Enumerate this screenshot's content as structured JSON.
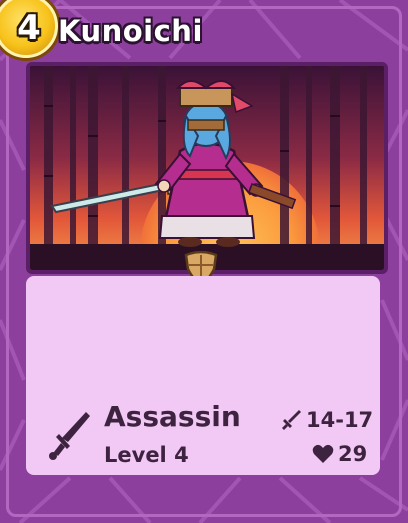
{
  "card": {
    "cost": "4",
    "name": "Kunoichi",
    "type": "Assassin",
    "level": "Level 4",
    "attack": "14-17",
    "health": "29"
  },
  "icons": {
    "cost_badge": "gold-coin",
    "charm": "shield-charm-icon",
    "type": "dagger-icon",
    "attack": "sword-icon",
    "health": "heart-icon"
  },
  "colors": {
    "frame": "#8d3f9e",
    "panel": "#f2c9f5",
    "text": "#3e2340",
    "cost_gold": "#f7c21a"
  }
}
